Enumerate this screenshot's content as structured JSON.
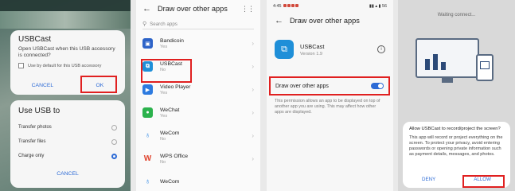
{
  "panel1": {
    "dialog_title": "USBCast",
    "dialog_message": "Open USBCast when this USB accessory is connected?",
    "checkbox_label": "Use by default for this USB accessory",
    "cancel_label": "CANCEL",
    "ok_label": "OK",
    "usb_title": "Use USB to",
    "usb_options": [
      "Transfer photos",
      "Transfer files",
      "Charge only"
    ],
    "usb_selected": "Charge only",
    "usb_cancel": "CANCEL"
  },
  "panel2": {
    "title": "Draw over other apps",
    "search_placeholder": "Search apps",
    "apps": [
      {
        "name": "Bandicoin",
        "status": "Yes",
        "icon": "bandicoin-icon",
        "color": "#2d63c8"
      },
      {
        "name": "USBCast",
        "status": "No",
        "icon": "usbcast-icon",
        "color": "#1f8fd8"
      },
      {
        "name": "Video Player",
        "status": "Yes",
        "icon": "video-player-icon",
        "color": "#2d7be0"
      },
      {
        "name": "WeChat",
        "status": "Yes",
        "icon": "wechat-icon",
        "color": "#2bb24c"
      },
      {
        "name": "WeCom",
        "status": "No",
        "icon": "wecom-icon",
        "color": "#3a8ee6"
      },
      {
        "name": "WPS Office",
        "status": "No",
        "icon": "wps-office-icon",
        "color": "#e0452f"
      },
      {
        "name": "WeCom",
        "status": "",
        "icon": "wecom-icon",
        "color": "#3a8ee6"
      }
    ]
  },
  "panel3": {
    "time": "4:45",
    "status_right": "56",
    "title": "Draw over other apps",
    "app_name": "USBCast",
    "app_version": "Version 1.9",
    "permission_label": "Draw over other apps",
    "permission_enabled": true,
    "permission_desc": "This permission allows an app to be displayed on top of another app you are using. This may affect how other apps are displayed."
  },
  "panel4": {
    "waiting_text": "Waiting connect...",
    "dialog_title": "Allow USBCast to record/project the screen?",
    "dialog_message": "This app will record or project everything on the screen. To protect your privacy, avoid entering passwords or opening private information such as payment details, messages, and photos.",
    "deny_label": "DENY",
    "allow_label": "ALLOW"
  },
  "colors": {
    "accent": "#2d6bd6",
    "highlight": "#e02020"
  }
}
